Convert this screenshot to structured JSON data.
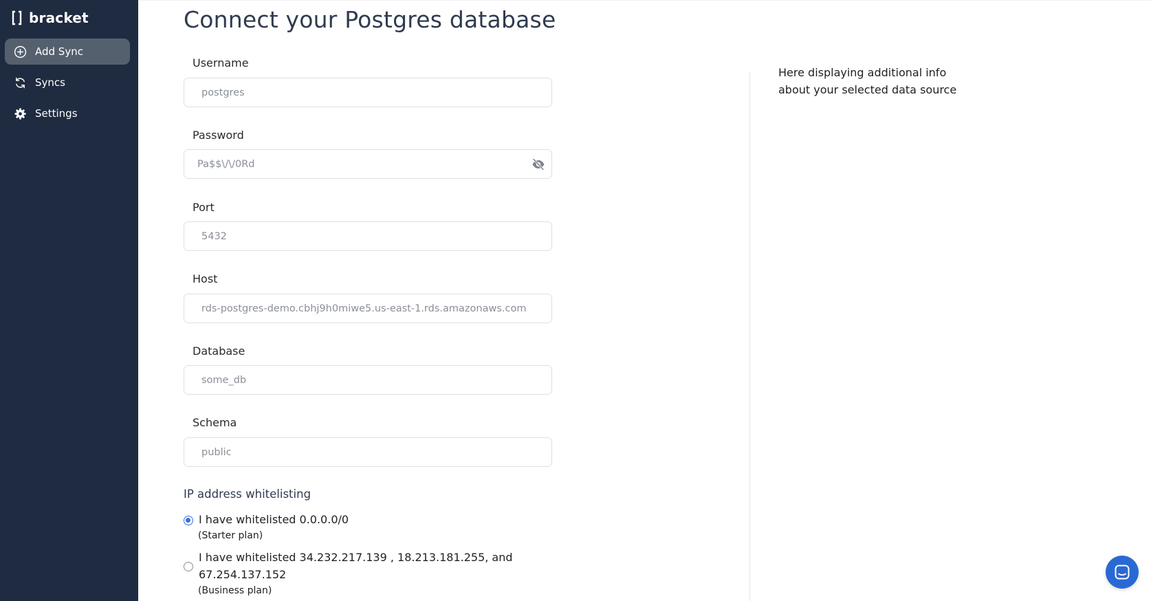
{
  "brand": {
    "name": "bracket"
  },
  "sidebar": {
    "items": [
      {
        "label": "Add Sync",
        "icon": "plus-circle-icon",
        "active": true
      },
      {
        "label": "Syncs",
        "icon": "refresh-icon",
        "active": false
      },
      {
        "label": "Settings",
        "icon": "gear-icon",
        "active": false
      }
    ]
  },
  "main": {
    "title": "Connect your Postgres database",
    "fields": [
      {
        "label": "Username",
        "placeholder": "postgres"
      },
      {
        "label": "Password",
        "placeholder": "Pa$$\\/\\/0Rd"
      },
      {
        "label": "Port",
        "placeholder": "5432"
      },
      {
        "label": "Host",
        "placeholder": "rds-postgres-demo.cbhj9h0miwe5.us-east-1.rds.amazonaws.com"
      },
      {
        "label": "Database",
        "placeholder": "some_db"
      },
      {
        "label": "Schema",
        "placeholder": "public"
      }
    ],
    "whitelist": {
      "title": "IP address whitelisting",
      "options": [
        {
          "line1": "I have whitelisted 0.0.0.0/0",
          "plan": "(Starter plan)",
          "selected": true
        },
        {
          "line1": "I have whitelisted 34.232.217.139 , 18.213.181.255, and",
          "line2": "67.254.137.152",
          "plan": "(Business plan)",
          "selected": false
        }
      ]
    }
  },
  "info_panel": {
    "line1": "Here displaying additional info",
    "line2": "about your selected data source"
  },
  "colors": {
    "sidebar_bg": "#1f2b40",
    "active_item_bg": "#55606f",
    "accent": "#3b6fd8",
    "chat_button": "#2a69d3"
  }
}
